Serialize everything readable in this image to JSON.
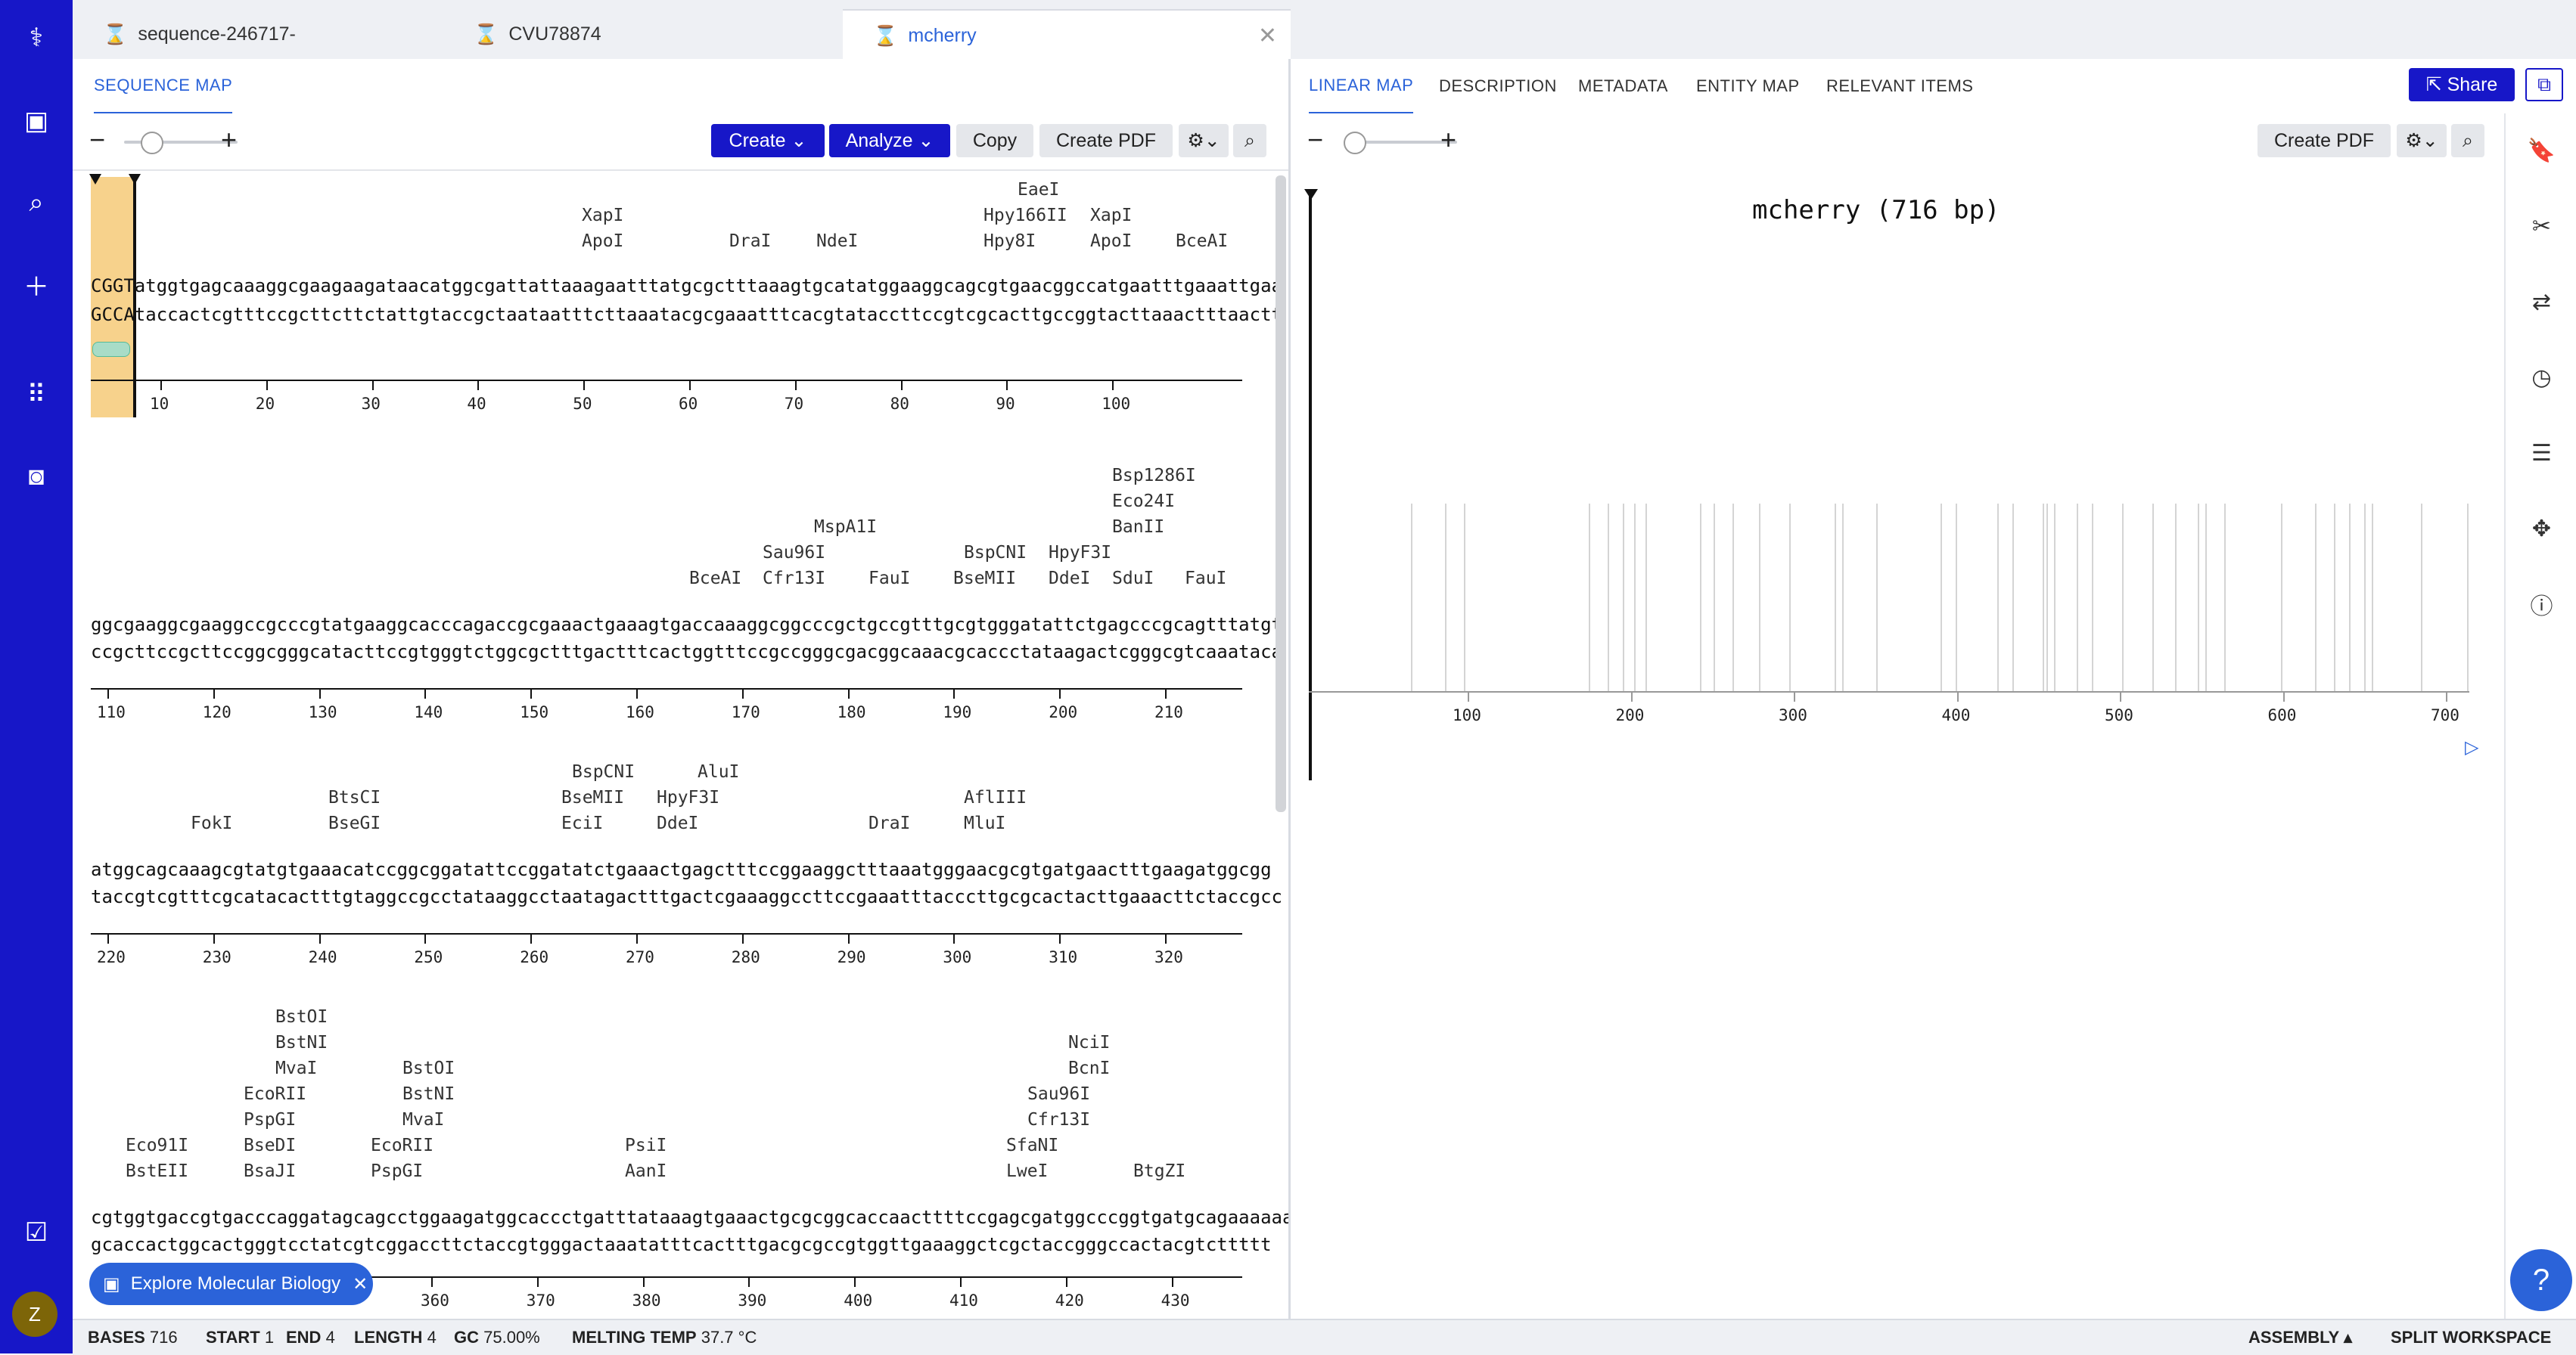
{
  "tabs": [
    {
      "label": "sequence-246717-",
      "active": false
    },
    {
      "label": "CVU78874",
      "active": false
    },
    {
      "label": "mcherry",
      "active": true
    }
  ],
  "left_pane": {
    "tab": "SEQUENCE MAP",
    "buttons": {
      "create": "Create",
      "analyze": "Analyze",
      "copy": "Copy",
      "create_pdf": "Create PDF"
    },
    "rows": [
      {
        "top": "CGGTatggtgagcaaaggcgaagaagataacatggcgattattaaagaatttatgcgctttaaagtgcatatggaaggcagcgtgaacggccatgaatttgaaattgaa",
        "bottom": "GCCAtaccactcgtttccgcttcttctattgtaccgctaataatttcttaaatacgcgaaatttcacgtataccttccgtcgcacttgccggtacttaaactttaactt",
        "ticks": [
          "10",
          "20",
          "30",
          "40",
          "50",
          "60",
          "70",
          "80",
          "90",
          "100"
        ],
        "enzymes": [
          "XapI",
          "ApoI",
          "DraI",
          "NdeI",
          "EaeI",
          "Hpy166II",
          "Hpy8I",
          "XapI",
          "ApoI",
          "BceAI"
        ]
      },
      {
        "top": "ggcgaaggcgaaggccgcccgtatgaaggcacccagaccgcgaaactgaaagtgaccaaaggcggcccgctgccgtttgcgtgggatattctgagcccgcagtttatgt",
        "bottom": "ccgcttccgcttccggcgggcatacttccgtgggtctggcgctttgactttcactggtttccgccgggcgacggcaaacgcaccctataagactcgggcgtcaaataca",
        "ticks": [
          "110",
          "120",
          "130",
          "140",
          "150",
          "160",
          "170",
          "180",
          "190",
          "200",
          "210"
        ],
        "enzymes": [
          "Bsp1286I",
          "Eco24I",
          "BanII",
          "MspA1I",
          "Sau96I",
          "Cfr13I",
          "BspCNI",
          "BseMII",
          "HpyF3I",
          "DdeI",
          "SduI",
          "FauI",
          "BceAI",
          "FauI",
          "FauI"
        ]
      },
      {
        "top": "atggcagcaaagcgtatgtgaaacatccggcggatattccggatatctgaaactgagctttccggaaggctttaaatgggaacgcgtgatgaactttgaagatggcgg",
        "bottom": "taccgtcgtttcgcatacactttgtaggccgcctataaggcctaatagactttgactcgaaaggccttccgaaatttacccttgcgcactacttgaaacttctaccgcc",
        "ticks": [
          "220",
          "230",
          "240",
          "250",
          "260",
          "270",
          "280",
          "290",
          "300",
          "310",
          "320"
        ],
        "enzymes": [
          "FokI",
          "BtsCI",
          "BseGI",
          "BspCNI",
          "BseMII",
          "EciI",
          "AluI",
          "HpyF3I",
          "DdeI",
          "DraI",
          "AflIII",
          "MluI"
        ]
      },
      {
        "top": "cgtggtgaccgtgacccaggatagcagcctggaagatggcaccctgatttataaagtgaaactgcgcggcaccaacttttccgagcgatggcccggtgatgcagaaaaaa",
        "bottom": "gcaccactggcactgggtcctatcgtcggaccttctaccgtgggactaaatatttcactttgacgcgccgtggttgaaaggctcgctaccgggccactacgtcttttt",
        "ticks": [
          "360",
          "370",
          "380",
          "390",
          "400",
          "410",
          "420",
          "430"
        ],
        "enzymes": [
          "Eco91I",
          "BstEII",
          "BstOI",
          "BstNI",
          "MvaI",
          "EcoRII",
          "PspGI",
          "BseDI",
          "BsaJI",
          "BstOI",
          "BstNI",
          "MvaI",
          "EcoRII",
          "PspGI",
          "PsiI",
          "AanI",
          "NciI",
          "BcnI",
          "Sau96I",
          "Cfr13I",
          "SfaNI",
          "LweI",
          "BtgZI"
        ]
      }
    ]
  },
  "right_pane": {
    "tabs": [
      "LINEAR MAP",
      "DESCRIPTION",
      "METADATA",
      "ENTITY MAP",
      "RELEVANT ITEMS"
    ],
    "share_label": "Share",
    "create_pdf": "Create PDF",
    "map_title": "mcherry (716 bp)",
    "ticks": [
      "100",
      "200",
      "300",
      "400",
      "500",
      "600",
      "700"
    ]
  },
  "explore_label": "Explore Molecular Biology",
  "status": {
    "bases_label": "BASES",
    "bases": "716",
    "start_label": "START",
    "start": "1",
    "end_label": "END",
    "end": "4",
    "length_label": "LENGTH",
    "length": "4",
    "gc_label": "GC",
    "gc": "75.00%",
    "melt_label": "MELTING TEMP",
    "melt": "37.7 °C",
    "assembly": "ASSEMBLY",
    "split": "SPLIT WORKSPACE"
  },
  "avatar_initial": "Z",
  "colors": {
    "nav": "#1717c8",
    "accent": "#2b63d9",
    "selection": "#f7d28c"
  },
  "icons": [
    "logo-icon",
    "briefcase-icon",
    "search-icon",
    "plus-icon",
    "grid-icon",
    "camera-icon",
    "tasks-icon",
    "bookmark-icon",
    "scissors-icon",
    "swap-icon",
    "history-icon",
    "list-icon",
    "settings-icon",
    "info-icon",
    "dna-icon",
    "gear-icon",
    "magnify-icon"
  ]
}
